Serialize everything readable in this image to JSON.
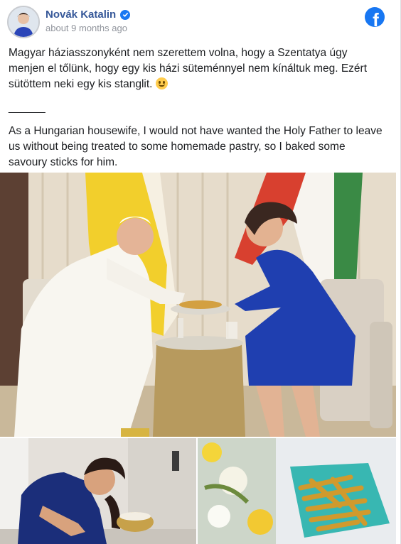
{
  "post": {
    "author": "Novák Katalin",
    "timestamp": "about 9 months ago",
    "paragraphs": {
      "hu": "Magyar háziasszonyként nem szerettem volna, hogy a Szentatya úgy menjen el tőlünk, hogy egy kis házi süteménnyel nem kínáltuk meg. Ezért sütöttem neki egy kis stanglit.",
      "divider": "______",
      "en": "As a Hungarian housewife, I would not have wanted the Holy Father to leave us without being treated to some homemade pastry, so I baked some savoury sticks for him."
    }
  },
  "icons": {
    "verified": "verified-badge-icon",
    "facebook": "facebook-logo-icon",
    "emoji": "smiling-face-emoji"
  },
  "colors": {
    "author_link": "#365899",
    "facebook_blue": "#1877f2",
    "meta_text": "#90949c"
  }
}
